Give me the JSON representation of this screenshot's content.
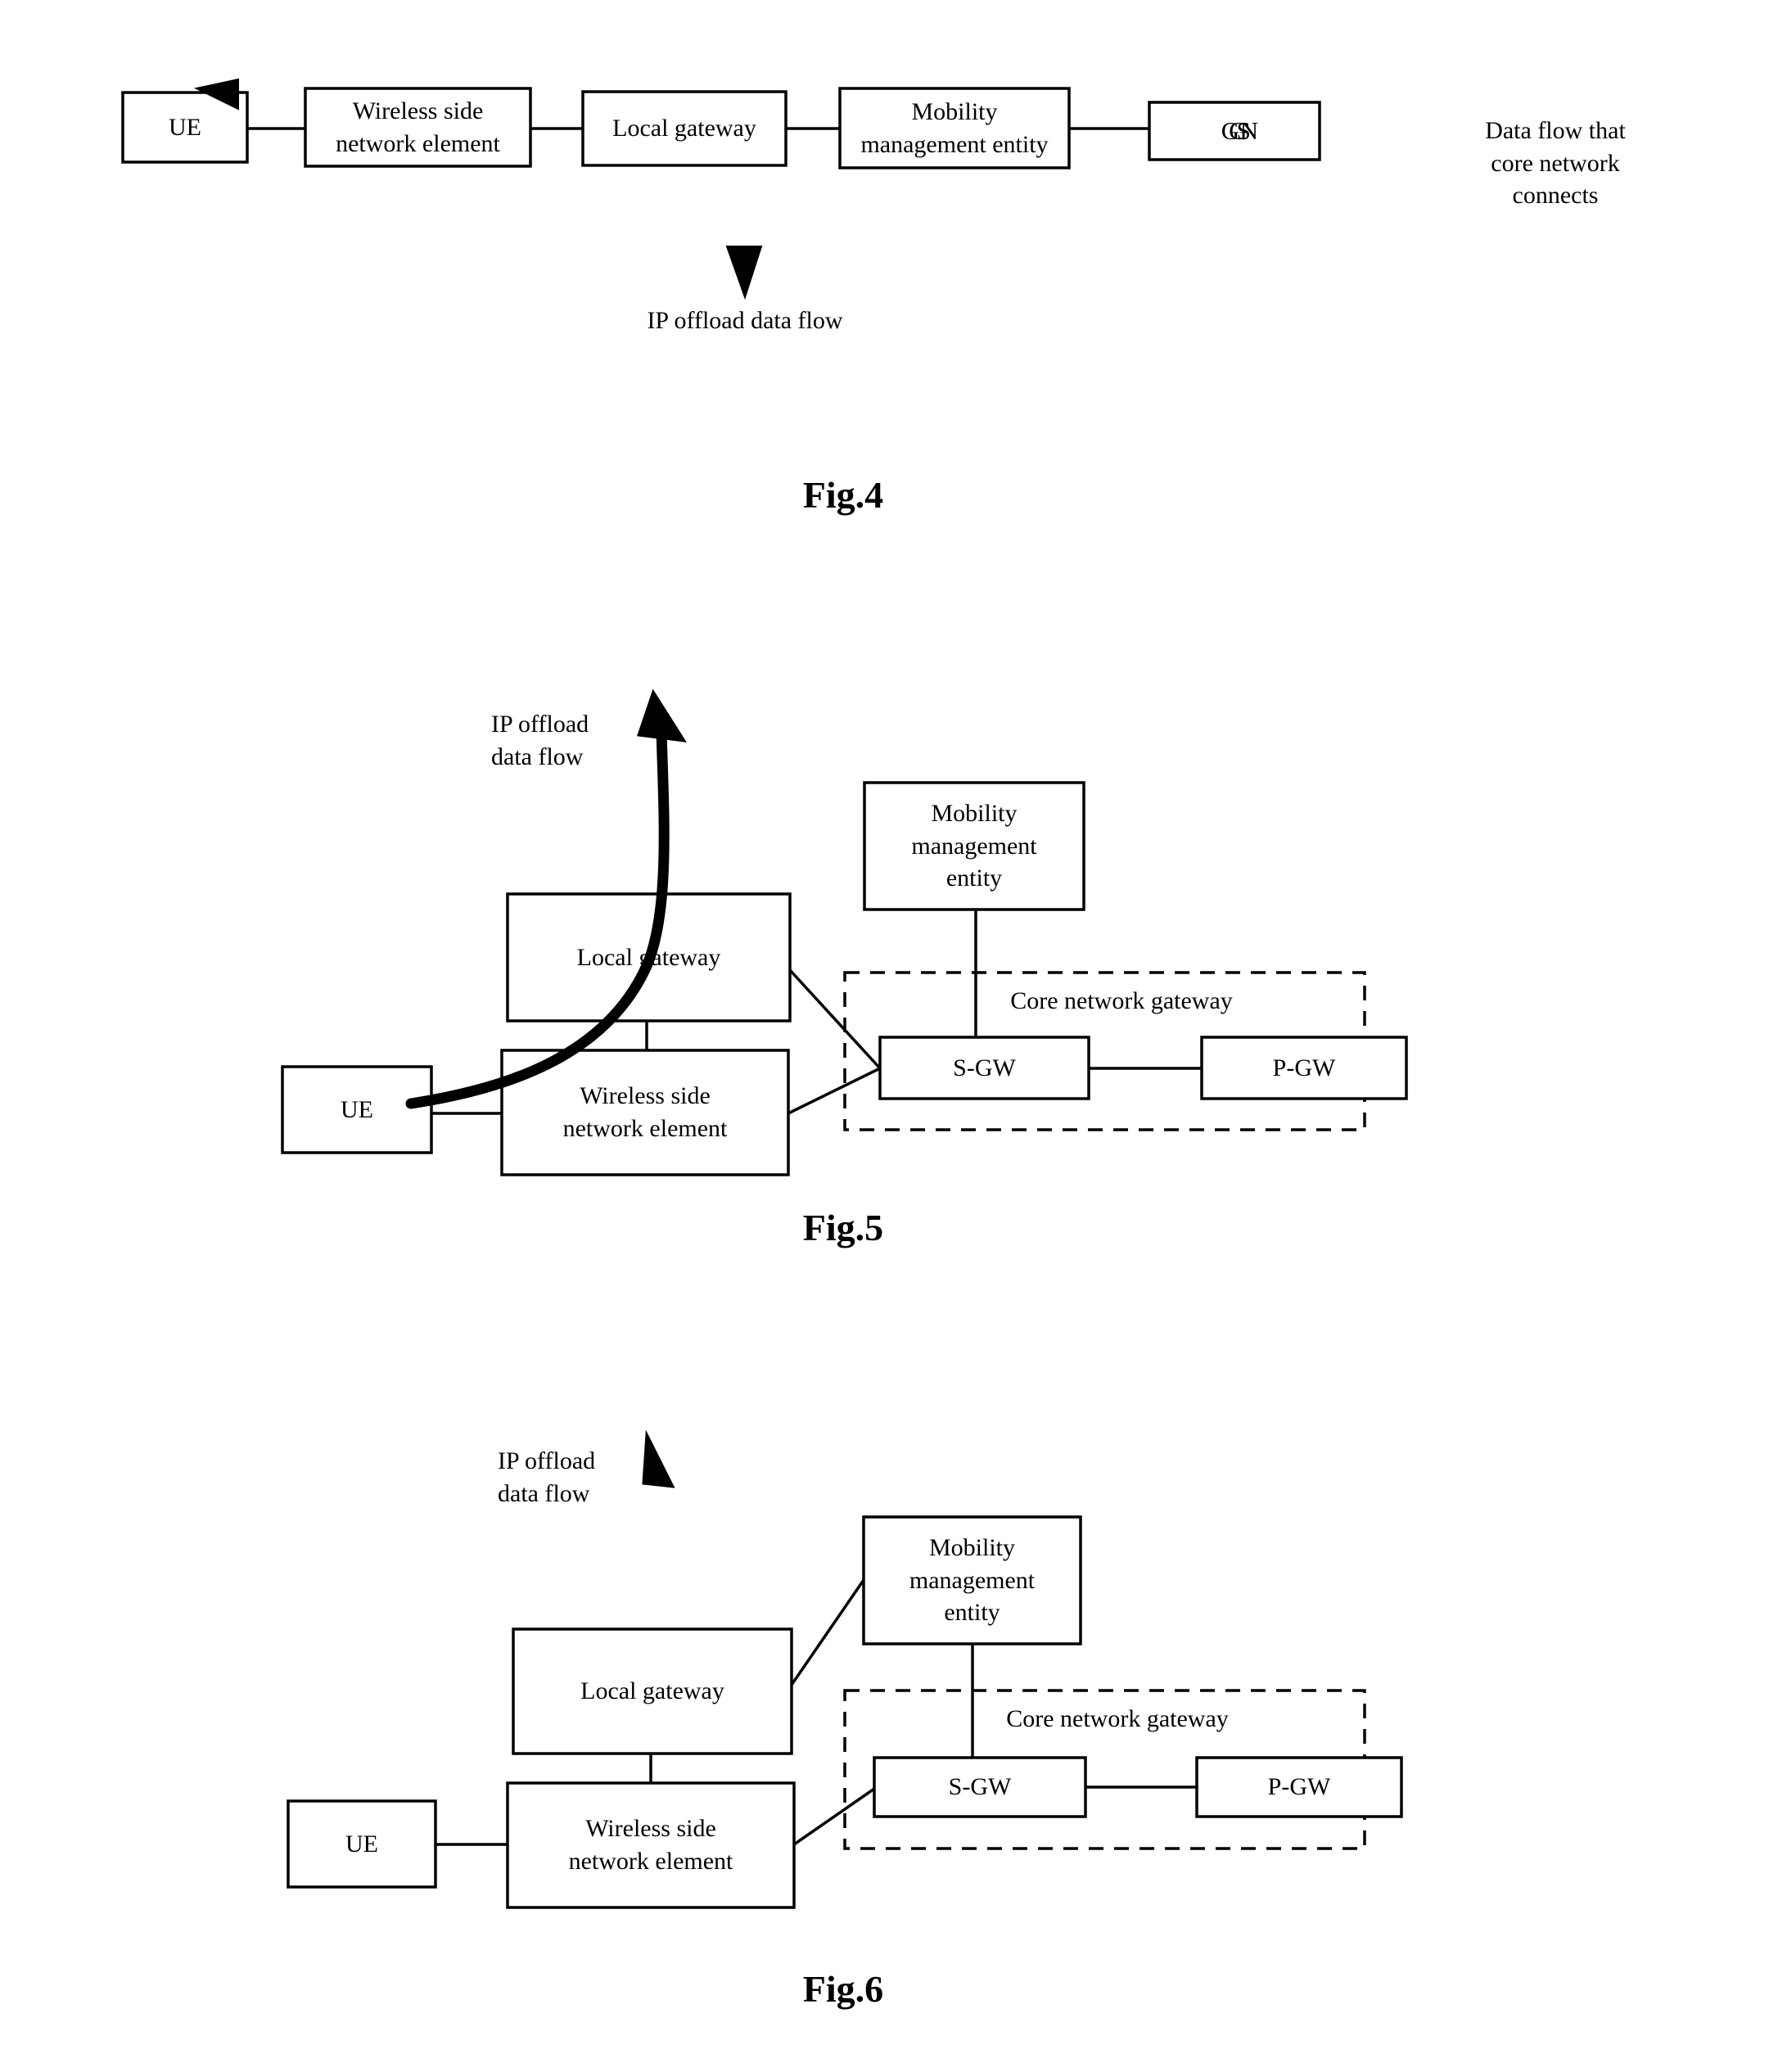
{
  "document": {
    "type": "patent-drawing-sheet",
    "figures": [
      "Fig.4",
      "Fig.5",
      "Fig.6"
    ]
  },
  "fig4": {
    "caption": "Fig.4",
    "boxes": {
      "ue": "UE",
      "wireless_side_network_element": "Wireless side\nnetwork element",
      "local_gateway": "Local gateway",
      "mobility_management_entity": "Mobility\nmanagement entity",
      "ggsn": "GGSN"
    },
    "annotations": {
      "core_network_flow": "Data flow that\ncore network\nconnects",
      "ip_offload_flow": "IP offload data flow"
    }
  },
  "fig5": {
    "caption": "Fig.5",
    "boxes": {
      "ue": "UE",
      "wireless_side_network_element": "Wireless side\nnetwork element",
      "local_gateway": "Local gateway",
      "mobility_management_entity": "Mobility\nmanagement\nentity",
      "core_network_gateway": "Core network gateway",
      "sgw": "S-GW",
      "pgw": "P-GW"
    },
    "annotations": {
      "ip_offload_flow": "IP offload\ndata flow"
    }
  },
  "fig6": {
    "caption": "Fig.6",
    "boxes": {
      "ue": "UE",
      "wireless_side_network_element": "Wireless side\nnetwork element",
      "local_gateway": "Local gateway",
      "mobility_management_entity": "Mobility\nmanagement\nentity",
      "core_network_gateway": "Core network gateway",
      "sgw": "S-GW",
      "pgw": "P-GW"
    },
    "annotations": {
      "ip_offload_flow": "IP offload\ndata flow"
    }
  },
  "colors": {
    "ink": "#000000",
    "paper": "#ffffff"
  }
}
